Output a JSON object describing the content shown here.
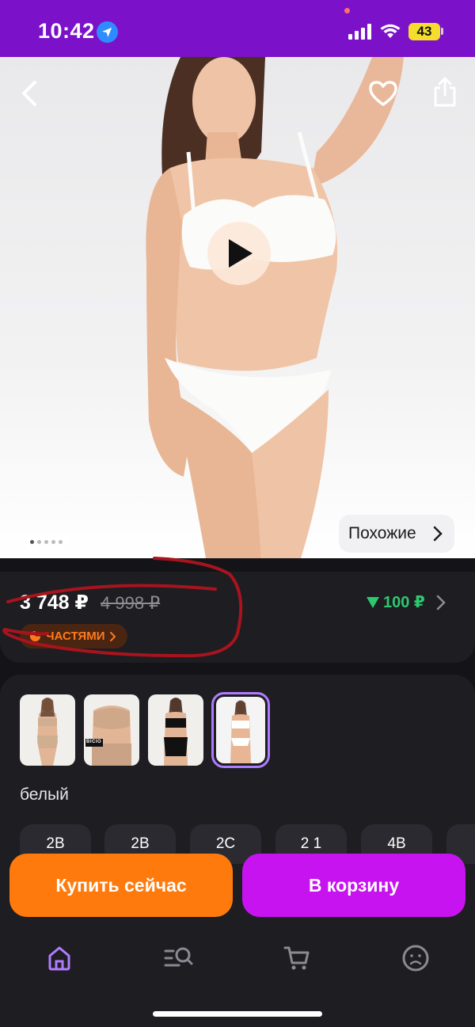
{
  "status_bar": {
    "time": "10:42",
    "battery": "43",
    "colors": {
      "bar": "#7B12C9",
      "battery": "#F5DD2C"
    },
    "icons": [
      "location-arrow-icon",
      "signal-icon",
      "wifi-icon",
      "battery-icon"
    ]
  },
  "hero": {
    "icons": [
      "back-arrow-icon",
      "heart-icon",
      "share-icon",
      "play-icon"
    ],
    "similar_label": "Похожие",
    "gallery": {
      "total": 5,
      "current": 1
    }
  },
  "price": {
    "current": "3 748 ₽",
    "old": "4 998 ₽",
    "bonus": "100 ₽",
    "installments": "ЧАСТЯМИ"
  },
  "variants": {
    "thumbnail_brand_text": "BICIO",
    "selected_color": "белый",
    "selected_index": 4,
    "sizes": [
      "2B",
      "2B",
      "2C",
      "2 1",
      "4B"
    ]
  },
  "actions": {
    "buy_now": "Купить сейчас",
    "add_to_cart": "В корзину",
    "colors": {
      "buy": "#FF7A0C",
      "cart": "#C613F0"
    }
  },
  "bottom_nav": {
    "items": [
      "home-icon",
      "catalog-search-icon",
      "cart-icon",
      "profile-icon"
    ],
    "active": "home-icon"
  }
}
